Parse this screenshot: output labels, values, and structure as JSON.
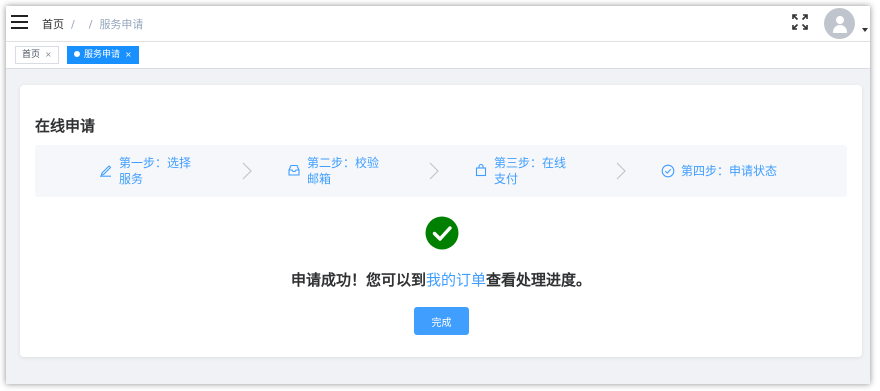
{
  "navbar": {
    "breadcrumb": {
      "home": "首页",
      "sep1": "/",
      "sep2": "/",
      "current": "服务申请"
    }
  },
  "tags": {
    "items": [
      {
        "label": "首页",
        "close": "×",
        "active": false
      },
      {
        "label": "服务申请",
        "close": "×",
        "active": true
      }
    ]
  },
  "main": {
    "title": "在线申请",
    "steps": [
      {
        "line1": "第一步：选择",
        "line2": "服务",
        "icon": "edit-icon"
      },
      {
        "line1": "第二步：校验",
        "line2": "邮箱",
        "icon": "inbox-icon"
      },
      {
        "line1": "第三步：在线",
        "line2": "支付",
        "icon": "bag-icon"
      },
      {
        "line1": "第四步：申请状态",
        "line2": "",
        "icon": "circle-check-icon"
      }
    ],
    "result": {
      "prefix": "申请成功！您可以到",
      "link": "我的订单",
      "suffix": "查看处理进度。"
    },
    "done_button": "完成"
  },
  "colors": {
    "primary": "#409eff",
    "tag_active": "#1890ff",
    "success": "#008000",
    "main_bg": "#f0f2f5",
    "steps_bg": "#f5f7fa"
  }
}
